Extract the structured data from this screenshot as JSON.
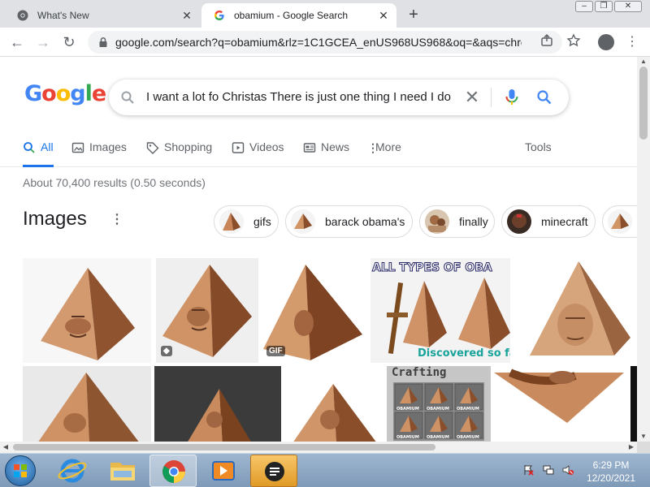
{
  "browser": {
    "tabs": [
      {
        "title": "What's New",
        "close_icon": "close-icon"
      },
      {
        "title": "obamium - Google Search",
        "close_icon": "close-icon"
      }
    ],
    "new_tab_label": "+",
    "window_controls": {
      "minimize": "‒",
      "maximize": "❐",
      "close": "✕"
    },
    "address_url": "google.com/search?q=obamium&rlz=1C1GCEA_enUS968US968&oq=&aqs=chro..."
  },
  "google": {
    "logo_letters": [
      {
        "ch": "G",
        "color": "#4285f4"
      },
      {
        "ch": "o",
        "color": "#ea4335"
      },
      {
        "ch": "o",
        "color": "#fbbc05"
      },
      {
        "ch": "g",
        "color": "#4285f4"
      },
      {
        "ch": "l",
        "color": "#34a853"
      },
      {
        "ch": "e",
        "color": "#ea4335"
      }
    ],
    "query": "I want a lot fo Christas There is just one thing I need I do",
    "clear_label": "✕"
  },
  "search_tabs": [
    {
      "label": "All",
      "icon": "search-icon",
      "active": true
    },
    {
      "label": "Images",
      "icon": "image-icon"
    },
    {
      "label": "Shopping",
      "icon": "tag-icon"
    },
    {
      "label": "Videos",
      "icon": "play-icon"
    },
    {
      "label": "News",
      "icon": "newspaper-icon"
    },
    {
      "label": "More",
      "icon": "more-vert-icon"
    }
  ],
  "tools_label": "Tools",
  "stats": "About 70,400 results (0.50 seconds)",
  "images_section": {
    "heading": "Images",
    "menu_glyph": "⋮",
    "chips": [
      {
        "label": "gifs"
      },
      {
        "label": "barack obama's"
      },
      {
        "label": "finally"
      },
      {
        "label": "minecraft"
      },
      {
        "label": ""
      }
    ],
    "results": [
      {
        "badge": ""
      },
      {
        "badge": "tag"
      },
      {
        "badge": "GIF"
      },
      {
        "overlay_top": "ALL TYPES OF OBA",
        "overlay_bottom": "Discovered so fa"
      },
      {
        "badge": ""
      },
      {
        "badge": ""
      },
      {
        "badge": ""
      },
      {
        "badge": ""
      },
      {
        "overlay_top": "Crafting",
        "grid_labels": [
          "OBAMIUM",
          "OBAMIUM",
          "OBAMIUM",
          "OBAMIUM",
          "OBAMIUM",
          "OBAMIUM"
        ]
      },
      {
        "badge": ""
      }
    ]
  },
  "taskbar": {
    "clock_time": "6:29 PM",
    "clock_date": "12/20/2021"
  },
  "colors": {
    "accent": "#1a73e8",
    "pyramid_light": "#d89a6c",
    "pyramid_dark": "#8a4f2a"
  }
}
